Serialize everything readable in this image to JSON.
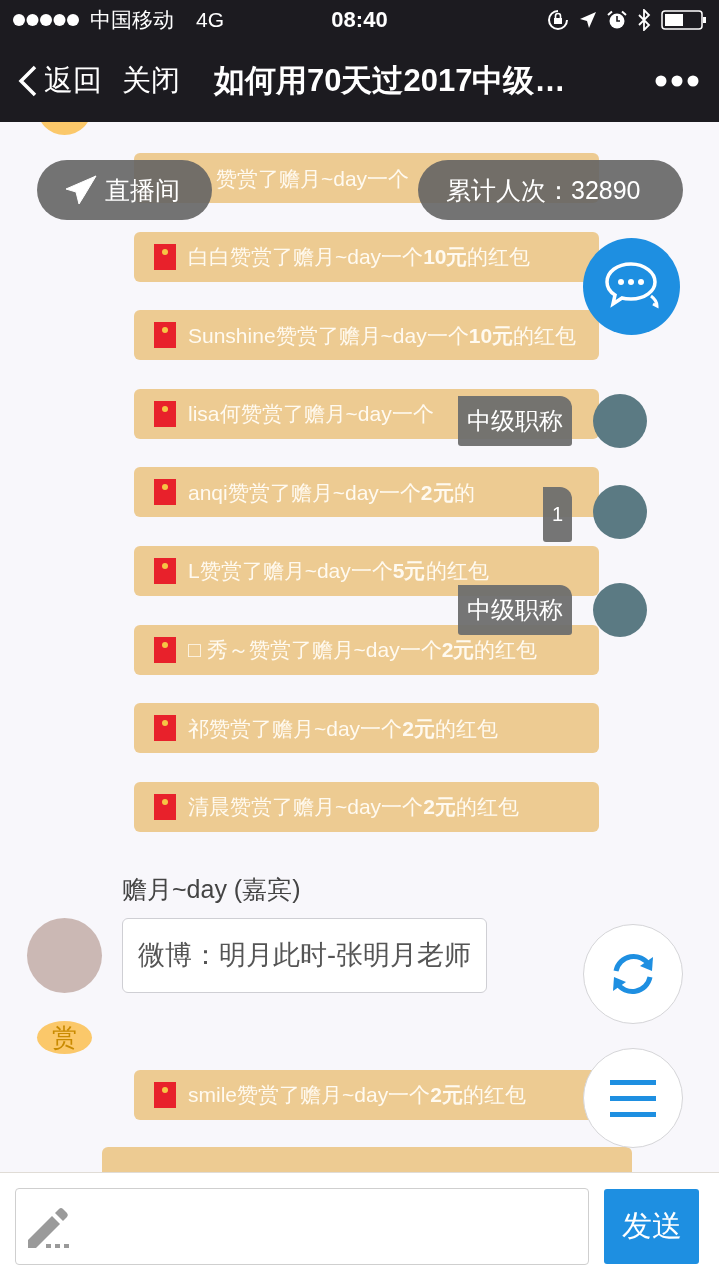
{
  "status_bar": {
    "carrier": "中国移动",
    "network": "4G",
    "time": "08:40"
  },
  "nav_bar": {
    "back": "返回",
    "close": "关闭",
    "title": "如何用70天过2017中级…"
  },
  "live_button": "直播间",
  "visitor_count": "累计人次：32890",
  "tips": [
    {
      "text": "赞赏了赡月~day一个",
      "icon": false
    },
    {
      "text": "白白赞赏了赡月~day一个**10元**的红包",
      "icon": true
    },
    {
      "text": "Sunshine赞赏了赡月~day一个**10元**的红包",
      "icon": true
    },
    {
      "text": "lisa何赞赏了赡月~day一个",
      "icon": true
    },
    {
      "text": "anqi赞赏了赡月~day一个**2元**的",
      "icon": true
    },
    {
      "text": "L赞赏了赡月~day一个**5元**的红包",
      "icon": true
    },
    {
      "text": "□ 秀～赞赏了赡月~day一个**2元**的红包",
      "icon": true
    },
    {
      "text": "祁赞赏了赡月~day一个**2元**的红包",
      "icon": true
    },
    {
      "text": "清晨赞赏了赡月~day一个**2元**的红包",
      "icon": true
    }
  ],
  "viewer_tags": [
    {
      "kind": "title",
      "text": "中级职称"
    },
    {
      "kind": "count",
      "text": "1"
    },
    {
      "kind": "title",
      "text": "中级职称"
    }
  ],
  "message": {
    "sender": "赡月~day (嘉宾)",
    "text": "微博：明月此时-张明月老师"
  },
  "reward_badge": "赏",
  "tips_after": [
    {
      "text": "smile赞赏了赡月~day一个**2元**的红包",
      "icon": true
    }
  ],
  "send_button": "发送"
}
